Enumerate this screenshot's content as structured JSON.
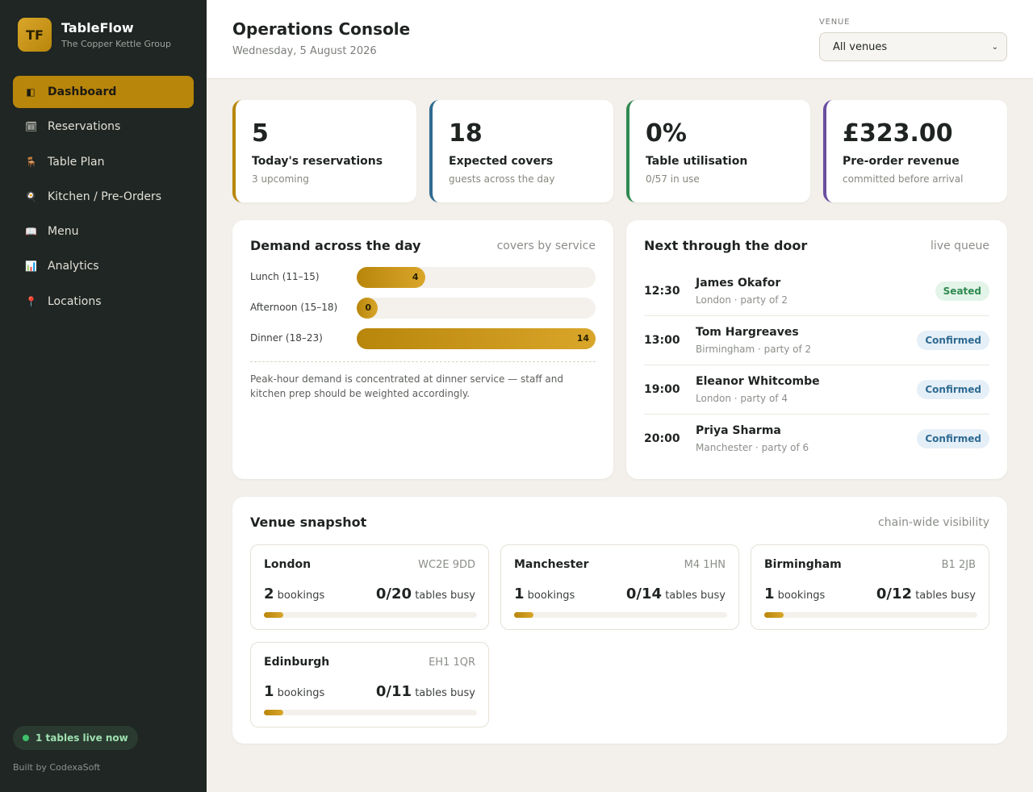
{
  "app": {
    "logo_initials": "TF",
    "name": "TableFlow",
    "group": "The Copper Kettle Group"
  },
  "nav": [
    {
      "label": "Dashboard",
      "icon": "◧",
      "icon_name": "dashboard-icon",
      "active": true
    },
    {
      "label": "Reservations",
      "icon": "🗓",
      "icon_name": "calendar-icon"
    },
    {
      "label": "Table Plan",
      "icon": "🪑",
      "icon_name": "chair-icon"
    },
    {
      "label": "Kitchen / Pre-Orders",
      "icon": "🍳",
      "icon_name": "pan-icon"
    },
    {
      "label": "Menu",
      "icon": "📖",
      "icon_name": "book-icon"
    },
    {
      "label": "Analytics",
      "icon": "📊",
      "icon_name": "chart-icon"
    },
    {
      "label": "Locations",
      "icon": "📍",
      "icon_name": "pin-icon"
    }
  ],
  "sidebar_footer": {
    "live": "1 tables live now",
    "built_by": "Built by CodexaSoft"
  },
  "header": {
    "title": "Operations Console",
    "date": "Wednesday, 5 August 2026",
    "venue_label": "VENUE",
    "venue_value": "All venues"
  },
  "stats": [
    {
      "value": "5",
      "label": "Today's reservations",
      "sub": "3 upcoming",
      "color": "#b8860b"
    },
    {
      "value": "18",
      "label": "Expected covers",
      "sub": "guests across the day",
      "color": "#2f6b93"
    },
    {
      "value": "0%",
      "label": "Table utilisation",
      "sub": "0/57 in use",
      "color": "#2f8a50"
    },
    {
      "value": "£323.00",
      "label": "Pre-order revenue",
      "sub": "committed before arrival",
      "color": "#6a4ea0"
    }
  ],
  "demand": {
    "title": "Demand across the day",
    "meta": "covers by service",
    "note": "Peak-hour demand is concentrated at dinner service — staff and kitchen prep should be weighted accordingly.",
    "max": 14,
    "rows": [
      {
        "label": "Lunch (11–15)",
        "value": 4
      },
      {
        "label": "Afternoon (15–18)",
        "value": 0
      },
      {
        "label": "Dinner (18–23)",
        "value": 14
      }
    ]
  },
  "queue": {
    "title": "Next through the door",
    "meta": "live queue",
    "items": [
      {
        "time": "12:30",
        "name": "James Okafor",
        "sub": "London · party of 2",
        "status": "Seated",
        "kind": "seated"
      },
      {
        "time": "13:00",
        "name": "Tom Hargreaves",
        "sub": "Birmingham · party of 2",
        "status": "Confirmed",
        "kind": "confirmed"
      },
      {
        "time": "19:00",
        "name": "Eleanor Whitcombe",
        "sub": "London · party of 4",
        "status": "Confirmed",
        "kind": "confirmed"
      },
      {
        "time": "20:00",
        "name": "Priya Sharma",
        "sub": "Manchester · party of 6",
        "status": "Confirmed",
        "kind": "confirmed"
      }
    ]
  },
  "venues": {
    "title": "Venue snapshot",
    "meta": "chain-wide visibility",
    "bookings_word": "bookings",
    "tables_word": "tables busy",
    "items": [
      {
        "name": "London",
        "code": "WC2E 9DD",
        "bookings": "2",
        "tables": "0/20",
        "level": 0.09
      },
      {
        "name": "Manchester",
        "code": "M4 1HN",
        "bookings": "1",
        "tables": "0/14",
        "level": 0.09
      },
      {
        "name": "Birmingham",
        "code": "B1 2JB",
        "bookings": "1",
        "tables": "0/12",
        "level": 0.09
      },
      {
        "name": "Edinburgh",
        "code": "EH1 1QR",
        "bookings": "1",
        "tables": "0/11",
        "level": 0.09
      }
    ]
  }
}
